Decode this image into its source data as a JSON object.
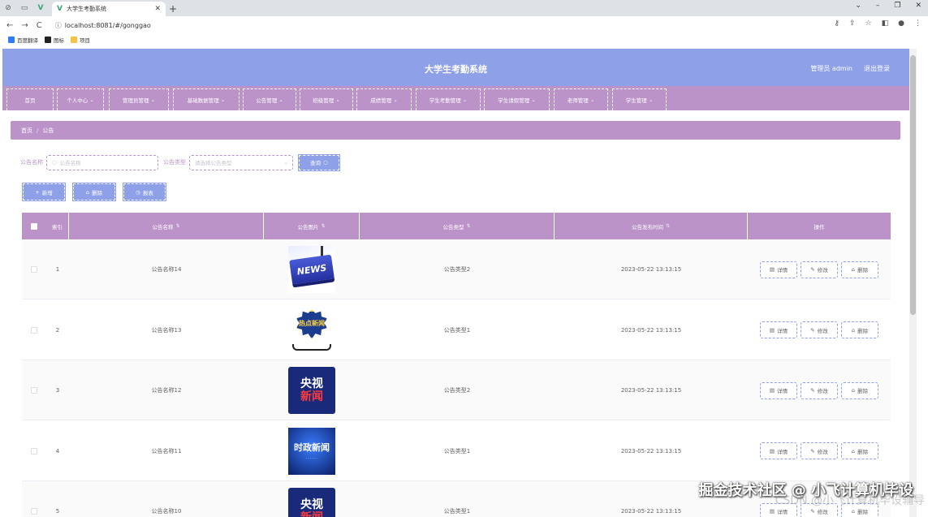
{
  "browser": {
    "tab_title": "大学生考勤系统",
    "url": "localhost:8081/#/gonggao",
    "bookmarks": [
      "百度翻译",
      "图标",
      "项目"
    ]
  },
  "header": {
    "title": "大学生考勤系统",
    "user": "管理员 admin",
    "logout": "退出登录"
  },
  "menu": [
    "首页",
    "个人中心",
    "管理员管理",
    "基础数据管理",
    "公告管理",
    "班级管理",
    "成绩管理",
    "学生考勤管理",
    "学生请假管理",
    "老师管理",
    "学生管理"
  ],
  "breadcrumb": {
    "home": "首页",
    "sep": "/",
    "current": "公告"
  },
  "search": {
    "name_label": "公告名称",
    "name_placeholder": "公告名称",
    "type_label": "公告类型",
    "type_placeholder": "请选择公告类型",
    "query_button": "查询"
  },
  "actions": {
    "add": "新增",
    "delete": "删除",
    "report": "报表"
  },
  "table": {
    "headers": {
      "index": "索引",
      "name": "公告名称",
      "image": "公告图片",
      "type": "公告类型",
      "time": "公告发布时间",
      "ops": "操作"
    },
    "ops": {
      "detail": "详情",
      "edit": "修改",
      "delete": "删除"
    },
    "rows": [
      {
        "index": "1",
        "name": "公告名称14",
        "image": "news-keyboard",
        "type": "公告类型2",
        "time": "2023-05-22 13:13:15"
      },
      {
        "index": "2",
        "name": "公告名称13",
        "image": "hot-news",
        "type": "公告类型1",
        "time": "2023-05-22 13:13:15"
      },
      {
        "index": "3",
        "name": "公告名称12",
        "image": "cctv-news",
        "type": "公告类型2",
        "time": "2023-05-22 13:13:15"
      },
      {
        "index": "4",
        "name": "公告名称11",
        "image": "politics-news",
        "type": "公告类型1",
        "time": "2023-05-22 13:13:15"
      },
      {
        "index": "5",
        "name": "公告名称10",
        "image": "cctv-news",
        "type": "公告类型1",
        "time": "2023-05-22 13:13:15"
      }
    ]
  },
  "images": {
    "news_text": "NEWS",
    "hot_news_text": "热点新闻",
    "cctv_line1": "央视",
    "cctv_line2": "新闻",
    "gov_text": "时政新闻"
  },
  "watermark": "掘金技术社区 @ 小飞计算机毕设",
  "watermark2": "CSDN @小飞计算机毕设辅导",
  "colors": {
    "primary": "#8ea0e8",
    "secondary": "#bb93c9"
  }
}
